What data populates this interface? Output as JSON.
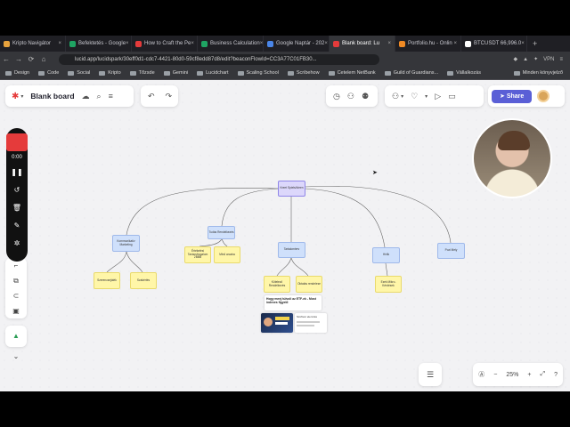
{
  "browser": {
    "tabs": [
      {
        "label": "Kripto Navigátor",
        "color": "#e8a33d",
        "active": false
      },
      {
        "label": "Befektetés - Google",
        "color": "#1fa463",
        "active": false
      },
      {
        "label": "How to Craft the Pe",
        "color": "#e53b3b",
        "active": false
      },
      {
        "label": "Business Calculation",
        "color": "#1fa463",
        "active": false
      },
      {
        "label": "Google Naptár - 202",
        "color": "#4a86e8",
        "active": false
      },
      {
        "label": "Blank board: Lu",
        "color": "#e53b3b",
        "active": true
      },
      {
        "label": "Portfolio.hu - Onlin",
        "color": "#f08a24",
        "active": false
      },
      {
        "label": "BTCUSDT 66,996.0",
        "color": "#ffffff",
        "active": false
      }
    ],
    "url": "lucid.app/lucidspark/30eff0d1-cdc7-4421-80d0-59cf8edd87d8/edit?beaconFlowId=CC3A77C01FB30...",
    "vpn_label": "VPN",
    "bookmarks": [
      "Design",
      "Code",
      "Social",
      "Kripto",
      "Tőzsde",
      "Gemini",
      "Lucidchart",
      "Scaling School",
      "Scribehow",
      "Cetelem NetBank",
      "Guild of Guardians...",
      "Vállalkozás"
    ],
    "other_bookmarks": "Minden könyvjelző"
  },
  "board": {
    "title": "Blank board",
    "share_label": "Share",
    "zoom": "25%"
  },
  "recorder": {
    "time": "0:00"
  },
  "diagram": {
    "root": "Kreet Spiels/Ideen",
    "nodes": [
      {
        "id": "a",
        "label": "Kommunikatív Marketing",
        "color": "blue"
      },
      {
        "id": "b",
        "label": "Tudás Rendelkezés",
        "color": "blue"
      },
      {
        "id": "c",
        "label": "Tartalomterv",
        "color": "blue"
      },
      {
        "id": "d",
        "label": "Hírlik",
        "color": "blue"
      },
      {
        "id": "e",
        "label": "Pozi Mely",
        "color": "blue"
      },
      {
        "id": "a1",
        "label": "Szerencsejáték",
        "color": "yellow"
      },
      {
        "id": "a2",
        "label": "Szakértés",
        "color": "yellow"
      },
      {
        "id": "b1",
        "label": "Értékelési Tanácsfrogalom 2BBB",
        "color": "yellow"
      },
      {
        "id": "b2",
        "label": "Minő arcaira",
        "color": "yellow"
      },
      {
        "id": "c1",
        "label": "Kötelező Rendelkezés",
        "color": "yellow"
      },
      {
        "id": "c2",
        "label": "Oktatás rendelese",
        "color": "yellow"
      },
      {
        "id": "d1",
        "label": "Ezek Mikro-Kérdések",
        "color": "yellow"
      }
    ],
    "card_title": "Hogy menj túlvoli az ETF-ek - Most indexes figyelő",
    "card_caption": "Szoftver elemzés"
  }
}
